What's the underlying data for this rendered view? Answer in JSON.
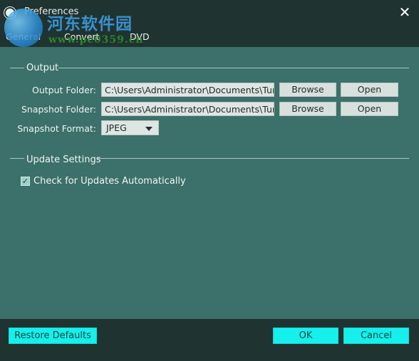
{
  "window": {
    "title": "Preferences",
    "close_glyph": "✕"
  },
  "watermark": {
    "chinese_text": "河东软件园",
    "url_text": "www.pc0359.cn"
  },
  "tabs": [
    {
      "label": "General"
    },
    {
      "label": "Convert"
    },
    {
      "label": "DVD"
    }
  ],
  "output": {
    "section_title": "Output",
    "output_folder_label": "Output Folder:",
    "output_folder_value": "C:\\Users\\Administrator\\Documents\\Tun",
    "snapshot_folder_label": "Snapshot Folder:",
    "snapshot_folder_value": "C:\\Users\\Administrator\\Documents\\Tun",
    "browse_label": "Browse",
    "open_label": "Open",
    "snapshot_format_label": "Snapshot Format:",
    "snapshot_format_value": "JPEG"
  },
  "update": {
    "section_title": "Update Settings",
    "check_label": "Check for Updates Automatically",
    "checked": true,
    "check_glyph": "✓"
  },
  "footer": {
    "restore_defaults_label": "Restore Defaults",
    "ok_label": "OK",
    "cancel_label": "Cancel"
  },
  "colors": {
    "background": "#3c706a",
    "bar": "#1f3330",
    "accent_button": "#15f0ec"
  }
}
